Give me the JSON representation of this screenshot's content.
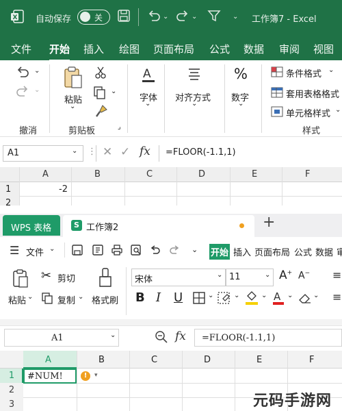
{
  "excel": {
    "autosave_label": "自动保存",
    "autosave_state": "关",
    "window_title": "工作簿7  -  Excel",
    "menu": [
      "文件",
      "开始",
      "插入",
      "绘图",
      "页面布局",
      "公式",
      "数据",
      "审阅",
      "视图"
    ],
    "active_menu": "开始",
    "ribbon": {
      "undo_group": "撤消",
      "paste": "粘贴",
      "clipboard_group": "剪贴板",
      "font": "字体",
      "align": "对齐方式",
      "number": "数字",
      "cond_format": "条件格式",
      "table_format": "套用表格格式",
      "cell_style": "单元格样式",
      "styles_group": "样式"
    },
    "name_box": "A1",
    "formula": "=FLOOR(-1.1,1)",
    "columns": [
      "A",
      "B",
      "C",
      "D",
      "E",
      "F"
    ],
    "rows": [
      "1",
      "2"
    ],
    "cell_a1": "-2"
  },
  "wps": {
    "app_tab": "WPS 表格",
    "doc_tab": "工作簿2",
    "file_menu": "文件",
    "menus": [
      "开始",
      "插入",
      "页面布局",
      "公式",
      "数据",
      "审"
    ],
    "ribbon": {
      "paste": "粘贴",
      "cut": "剪切",
      "copy": "复制",
      "format_painter": "格式刷",
      "font_name": "宋体",
      "font_size": "11"
    },
    "name_box": "A1",
    "formula": "=FLOOR(-1.1,1)",
    "columns": [
      "A",
      "B",
      "C",
      "D",
      "E",
      "F"
    ],
    "rows": [
      "1",
      "2",
      "3"
    ],
    "cell_a1": "#NUM!"
  },
  "watermark": "元码手游网",
  "colors": {
    "excel_green": "#1f7246",
    "wps_green": "#1f9b68",
    "error_orange": "#f0a020"
  }
}
